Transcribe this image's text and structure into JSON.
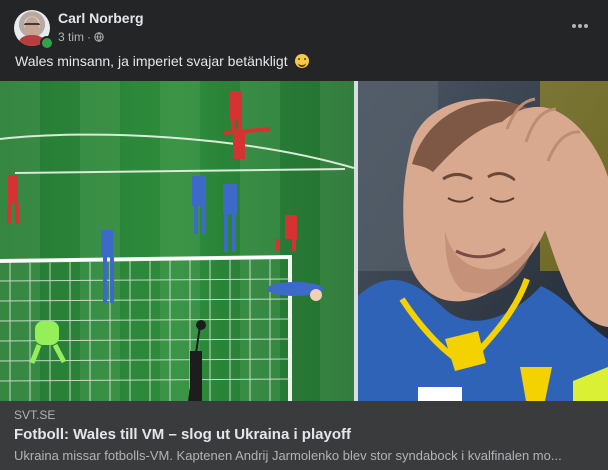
{
  "post": {
    "author": "Carl Norberg",
    "time": "3 tim",
    "separator": "·",
    "privacy_icon": "globe-icon",
    "caption": "Wales minsann, ja imperiet svajar betänkligt",
    "emoji": "smiling-face-icon",
    "more_icon": "more-options-icon"
  },
  "link": {
    "domain": "SVT.SE",
    "title": "Fotboll: Wales till VM – slog ut Ukraina i playoff",
    "description": "Ukraina missar fotbolls-VM. Kaptenen Andrij Jarmolenko blev stor syndabock i kvalfinalen mo..."
  },
  "colors": {
    "background": "#242526",
    "text_primary": "#e4e6eb",
    "text_secondary": "#b0b3b8",
    "link_box": "#3a3b3c",
    "online": "#31a24c"
  }
}
